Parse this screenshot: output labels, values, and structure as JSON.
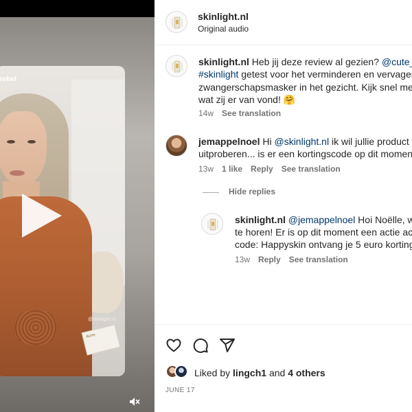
{
  "video": {
    "overlay_username": "rebel",
    "watermark": "@skinlight.nl",
    "product_label": "Acne"
  },
  "post": {
    "account": "skinlight.nl",
    "audio": "Original audio"
  },
  "comments": [
    {
      "author": "skinlight.nl",
      "line1_prefix": "Heb jij deze review al gezien? ",
      "line1_mention": "@cute_rebel",
      "line2_hashtag": "#skinlight",
      "line2_rest": " getest voor het verminderen en vervagen",
      "line3": "zwangerschapsmasker in het gezicht. Kijk snel mee c",
      "line4": "wat zij er van vond! 🤗",
      "time": "14w",
      "see_translation": "See translation"
    },
    {
      "author": "jemappelnoel",
      "line1_prefix": "Hi ",
      "line1_mention": "@skinlight.nl",
      "line1_rest": " ik wil jullie product w",
      "line2": "uitproberen... is er een kortingscode op dit moment",
      "time": "13w",
      "likes": "1 like",
      "reply": "Reply",
      "see_translation": "See translation"
    }
  ],
  "hide_replies": "Hide replies",
  "reply_comment": {
    "author": "skinlight.nl",
    "mention": "@jemappelnoel",
    "line1_rest": " Hoi Noëlle, wat",
    "line2": "te horen! Er is op dit moment een actie acti",
    "line3": "code: Happyskin ontvang je 5 euro korting",
    "time": "13w",
    "reply": "Reply",
    "see_translation": "See translation"
  },
  "likes": {
    "prefix": "Liked by ",
    "user": "lingch1",
    "middle": " and ",
    "others": "4 others"
  },
  "date": "JUNE 17",
  "icons": [
    "heart-icon",
    "comment-icon",
    "share-icon",
    "mute-icon",
    "play-icon"
  ]
}
